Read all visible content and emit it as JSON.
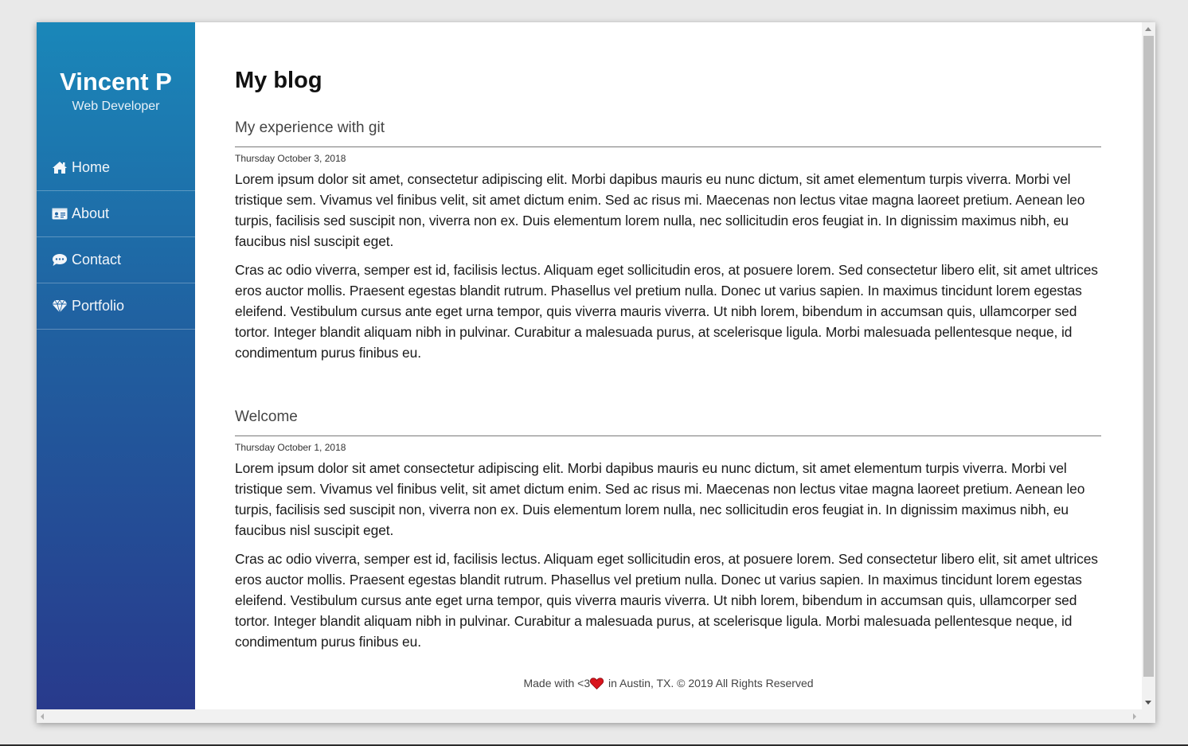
{
  "sidebar": {
    "name": "Vincent P",
    "role": "Web Developer",
    "items": [
      {
        "label": "Home",
        "icon": "home-icon"
      },
      {
        "label": "About",
        "icon": "id-card-icon"
      },
      {
        "label": "Contact",
        "icon": "chat-icon"
      },
      {
        "label": "Portfolio",
        "icon": "diamond-icon"
      }
    ],
    "gradient_top": "#1a87b9",
    "gradient_bottom": "#283a8c"
  },
  "main": {
    "title": "My blog",
    "posts": [
      {
        "title": "My experience with git",
        "date": "Thursday October 3, 2018",
        "paragraphs": [
          "Lorem ipsum dolor sit amet, consectetur adipiscing elit. Morbi dapibus mauris eu nunc dictum, sit amet elementum turpis viverra. Morbi vel tristique sem. Vivamus vel finibus velit, sit amet dictum enim. Sed ac risus mi. Maecenas non lectus vitae magna laoreet pretium. Aenean leo turpis, facilisis sed suscipit non, viverra non ex. Duis elementum lorem nulla, nec sollicitudin eros feugiat in. In dignissim maximus nibh, eu faucibus nisl suscipit eget.",
          "Cras ac odio viverra, semper est id, facilisis lectus. Aliquam eget sollicitudin eros, at posuere lorem. Sed consectetur libero elit, sit amet ultrices eros auctor mollis. Praesent egestas blandit rutrum. Phasellus vel pretium nulla. Donec ut varius sapien. In maximus tincidunt lorem egestas eleifend. Vestibulum cursus ante eget urna tempor, quis viverra mauris viverra. Ut nibh lorem, bibendum in accumsan quis, ullamcorper sed tortor. Integer blandit aliquam nibh in pulvinar. Curabitur a malesuada purus, at scelerisque ligula. Morbi malesuada pellentesque neque, id condimentum purus finibus eu."
        ]
      },
      {
        "title": "Welcome",
        "date": "Thursday October 1, 2018",
        "paragraphs": [
          "Lorem ipsum dolor sit amet consectetur adipiscing elit. Morbi dapibus mauris eu nunc dictum, sit amet elementum turpis viverra. Morbi vel tristique sem. Vivamus vel finibus velit, sit amet dictum enim. Sed ac risus mi. Maecenas non lectus vitae magna laoreet pretium. Aenean leo turpis, facilisis sed suscipit non, viverra non ex. Duis elementum lorem nulla, nec sollicitudin eros feugiat in. In dignissim maximus nibh, eu faucibus nisl suscipit eget.",
          "Cras ac odio viverra, semper est id, facilisis lectus. Aliquam eget sollicitudin eros, at posuere lorem. Sed consectetur libero elit, sit amet ultrices eros auctor mollis. Praesent egestas blandit rutrum. Phasellus vel pretium nulla. Donec ut varius sapien. In maximus tincidunt lorem egestas eleifend. Vestibulum cursus ante eget urna tempor, quis viverra mauris viverra. Ut nibh lorem, bibendum in accumsan quis, ullamcorper sed tortor. Integer blandit aliquam nibh in pulvinar. Curabitur a malesuada purus, at scelerisque ligula. Morbi malesuada pellentesque neque, id condimentum purus finibus eu."
        ]
      }
    ]
  },
  "footer": {
    "prefix": "Made with <3",
    "suffix": " in Austin, TX. © 2019 All Rights Reserved",
    "heart_icon": "heart-icon",
    "heart_color": "#d9141c"
  }
}
